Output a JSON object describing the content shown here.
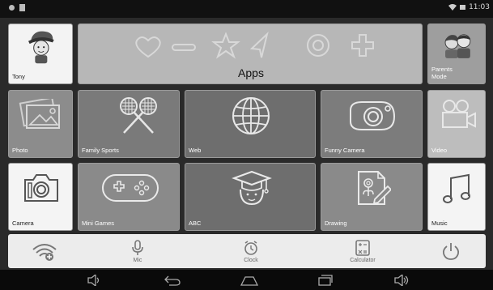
{
  "status": {
    "time": "11:03"
  },
  "user": {
    "name": "Tony"
  },
  "apps_banner": {
    "label": "Apps"
  },
  "parents": {
    "label_line1": "Parents",
    "label_line2": "Mode"
  },
  "tiles": {
    "photo": "Photo",
    "family_sports": "Family Sports",
    "web": "Web",
    "funny_camera": "Funny Camera",
    "video": "Video",
    "camera": "Camera",
    "mini_games": "Mini Games",
    "abc": "ABC",
    "drawing": "Drawing",
    "music": "Music"
  },
  "dock": {
    "mic": "Mic",
    "clock": "Clock",
    "calculator": "Calculator"
  },
  "colors": {
    "tile_dark": "#6b6b6b",
    "tile_mid": "#8f8f8f",
    "tile_light": "#b9b9b9",
    "tile_white": "#f4f4f4"
  }
}
